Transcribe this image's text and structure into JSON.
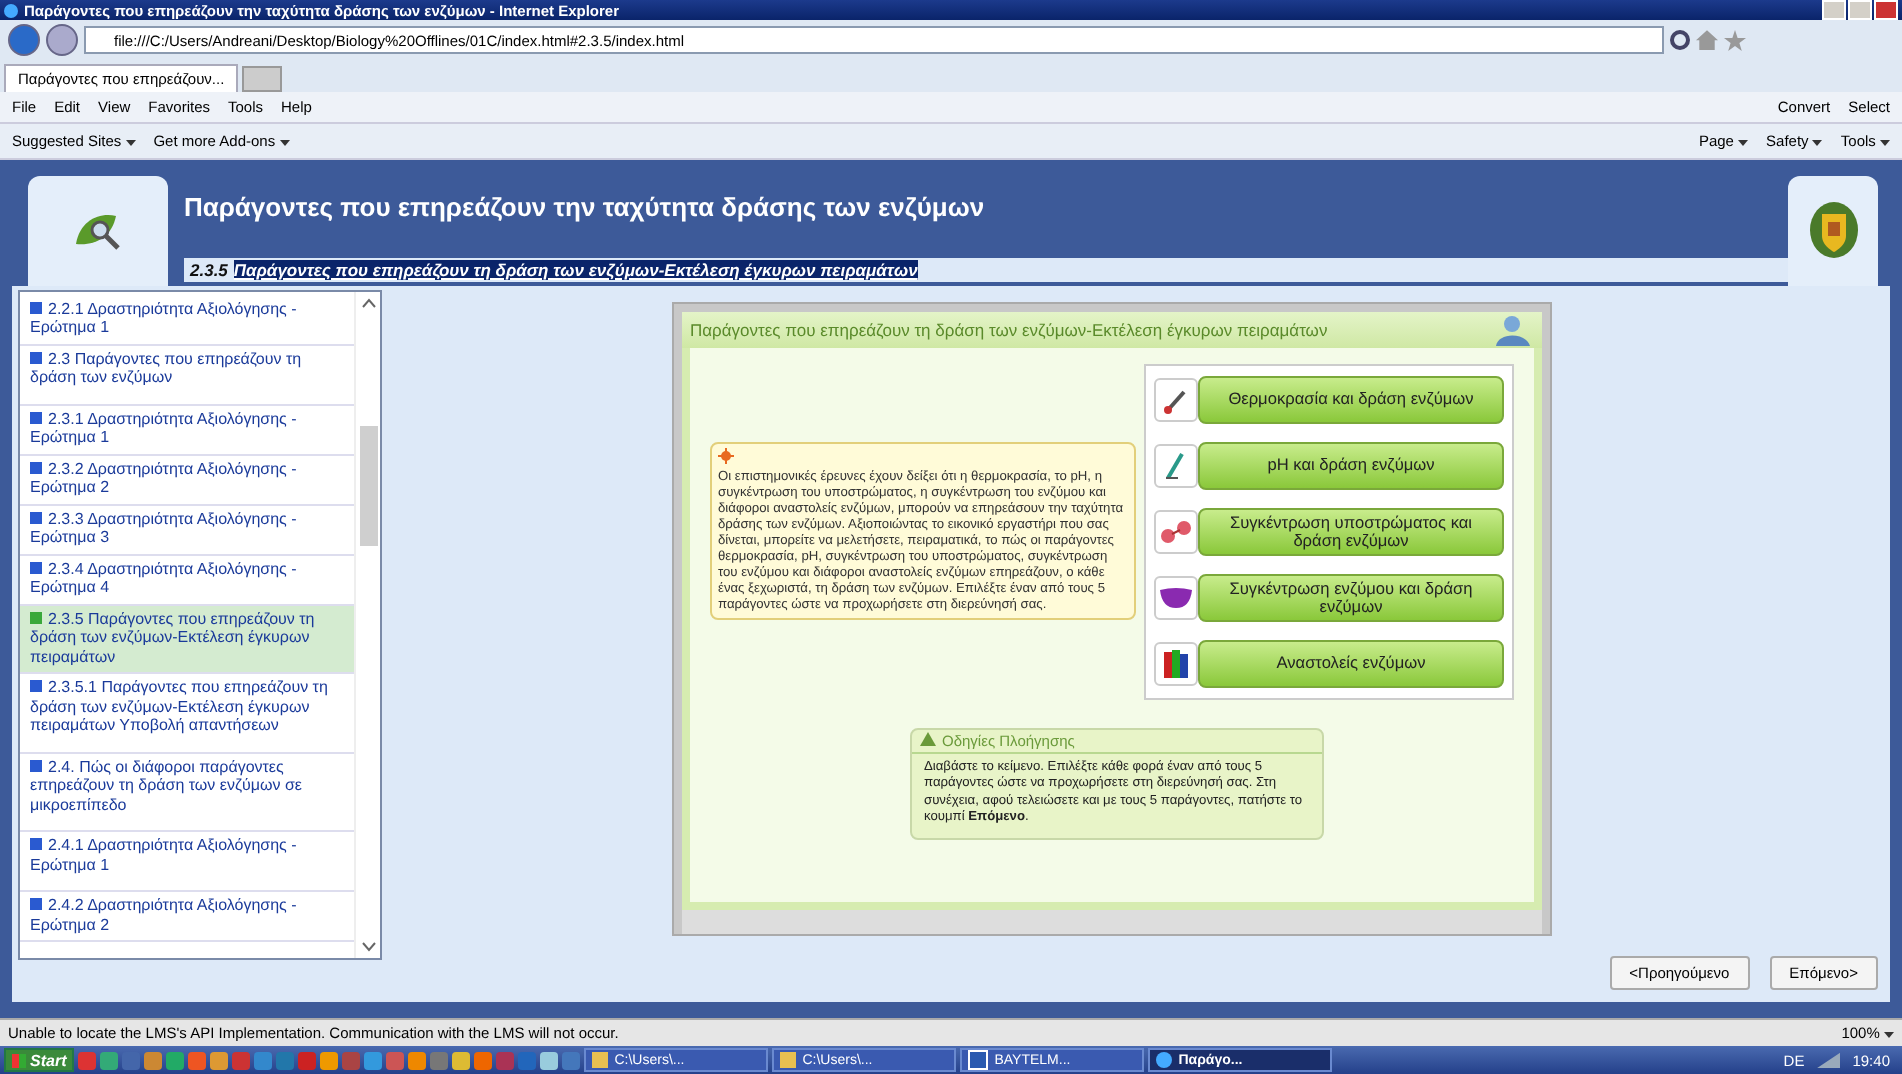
{
  "window": {
    "title": "Παράγοντες που επηρεάζουν την ταχύτητα δράσης των ενζύμων - Internet Explorer"
  },
  "address_bar": {
    "url": "file:///C:/Users/Andreani/Desktop/Biology%20Offlines/01C/index.html#2.3.5/index.html"
  },
  "tabs": [
    {
      "label": "Παράγοντες που επηρεάζουν...",
      "selected": true
    }
  ],
  "menu_bar": {
    "items": [
      "File",
      "Edit",
      "View",
      "Favorites",
      "Tools",
      "Help"
    ],
    "right": [
      "Convert",
      "Select"
    ]
  },
  "favorites_bar": {
    "items": [
      "Suggested Sites",
      "Get more Add-ons"
    ],
    "right": [
      "Page",
      "Safety",
      "Tools"
    ]
  },
  "header": {
    "title": "Παράγοντες που επηρεάζουν την ταχύτητα δράσης των ενζύμων",
    "section_number": "2.3.5",
    "section_title": "Παράγοντες που επηρεάζουν τη δράση των ενζύμων-Εκτέλεση έγκυρων πειραμάτων"
  },
  "sidebar": {
    "items": [
      {
        "label": "2.2.1 Δραστηριότητα Αξιολόγησης - Ερώτημα 1",
        "selected": false
      },
      {
        "label": "2.3 Παράγοντες που επηρεάζουν τη δράση των ενζύμων",
        "selected": false
      },
      {
        "label": "2.3.1 Δραστηριότητα Αξιολόγησης - Ερώτημα 1",
        "selected": false
      },
      {
        "label": "2.3.2 Δραστηριότητα Αξιολόγησης - Ερώτημα 2",
        "selected": false
      },
      {
        "label": "2.3.3 Δραστηριότητα Αξιολόγησης - Ερώτημα 3",
        "selected": false
      },
      {
        "label": "2.3.4 Δραστηριότητα Αξιολόγησης - Ερώτημα 4",
        "selected": false
      },
      {
        "label": "2.3.5 Παράγοντες που επηρεάζουν τη δράση των ενζύμων-Εκτέλεση έγκυρων πειραμάτων",
        "selected": true
      },
      {
        "label": "2.3.5.1 Παράγοντες που επηρεάζουν τη δράση των ενζύμων-Εκτέλεση έγκυρων πειραμάτων Υποβολή απαντήσεων",
        "selected": false
      },
      {
        "label": "2.4. Πώς οι διάφοροι παράγοντες επηρεάζουν τη δράση των ενζύμων σε μικροεπίπεδο",
        "selected": false
      },
      {
        "label": "2.4.1 Δραστηριότητα Αξιολόγησης - Ερώτημα 1",
        "selected": false
      },
      {
        "label": "2.4.2 Δραστηριότητα Αξιολόγησης - Ερώτημα 2",
        "selected": false
      }
    ]
  },
  "panel": {
    "title": "Παράγοντες που επηρεάζουν τη δράση των ενζύμων-Εκτέλεση έγκυρων πειραμάτων",
    "info_text": "Οι επιστημονικές έρευνες έχουν δείξει ότι η θερμοκρασία, το pH, η συγκέντρωση του υποστρώματος, η συγκέντρωση του ενζύμου και διάφοροι αναστολείς ενζύμων, μπορούν να επηρεάσουν την ταχύτητα δράσης των ενζύμων. Αξιοποιώντας το εικονικό εργαστήρι που σας δίνεται, μπορείτε να μελετήσετε, πειραματικά, το πώς οι παράγοντες θερμοκρασία, pH, συγκέντρωση του υποστρώματος, συγκέντρωση του ενζύμου και διάφοροι αναστολείς ενζύμων επηρεάζουν, ο κάθε ένας ξεχωριστά, τη δράση των ενζύμων. Επιλέξτε έναν από τους 5 παράγοντες ώστε να προχωρήσετε στη διερεύνησή σας.",
    "factors": [
      {
        "kind": "thermometer",
        "label": "Θερμοκρασία και δράση ενζύμων"
      },
      {
        "kind": "ph",
        "label": "pH και δράση ενζύμων"
      },
      {
        "kind": "substrate",
        "label": "Συγκέντρωση υποστρώματος και δράση ενζύμων"
      },
      {
        "kind": "enzyme",
        "label": "Συγκέντρωση ενζύμου και δράση ενζύμων"
      },
      {
        "kind": "inhibitor",
        "label": "Αναστολείς ενζύμων"
      }
    ],
    "instructions": {
      "title": "Οδηγίες Πλοήγησης",
      "text": "Διαβάστε το κείμενο. Επιλέξτε κάθε φορά έναν από τους 5 παράγοντες ώστε να προχωρήσετε στη διερεύνησή σας. Στη συνέχεια, αφού τελειώσετε και με τους 5 παράγοντες, πατήστε το κουμπί **Επόμενο**."
    }
  },
  "navigation": {
    "previous": "<Προηγούμενο",
    "next": "Επόμενο>"
  },
  "status_bar": {
    "message": "Unable to locate the LMS's API Implementation. Communication with the LMS will not occur.",
    "zoom": "100%"
  },
  "taskbar": {
    "start": "Start",
    "windows": [
      {
        "label": "C:\\Users\\...",
        "kind": "folder",
        "selected": false
      },
      {
        "label": "C:\\Users\\...",
        "kind": "folder",
        "selected": false
      },
      {
        "label": "BAYTELM...",
        "kind": "word",
        "selected": false
      },
      {
        "label": "Παράγο...",
        "kind": "browser",
        "selected": true
      }
    ],
    "language": "DE",
    "time": "19:40"
  }
}
